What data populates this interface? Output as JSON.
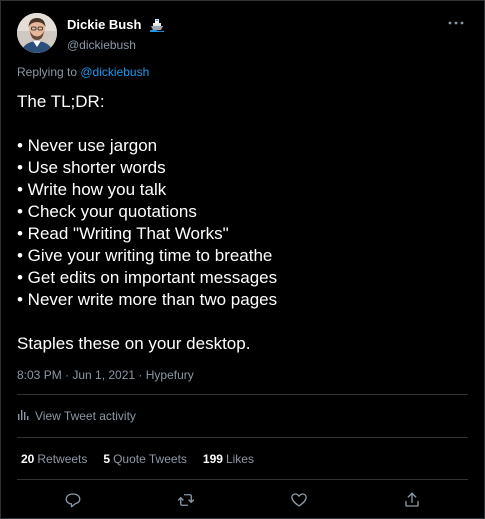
{
  "author": {
    "name": "Dickie Bush",
    "handle": "@dickiebush",
    "emoji": "ship-emoji-icon",
    "avatar": "avatar-photo"
  },
  "reply": {
    "prefix": "Replying to ",
    "mention": "@dickiebush"
  },
  "tweet": {
    "lines": [
      "The TL;DR:",
      "",
      "• Never use jargon",
      "• Use shorter words",
      "• Write how you talk",
      "• Check your quotations",
      "• Read \"Writing That Works\"",
      "• Give your writing time to breathe",
      "• Get edits on important messages",
      "• Never write more than two pages",
      "",
      "Staples these on your desktop."
    ]
  },
  "meta": {
    "text": "8:03 PM · Jun 1, 2021 · Hypefury"
  },
  "activity": {
    "label": "View Tweet activity",
    "icon": "bar-chart-icon"
  },
  "stats": {
    "retweets_count": "20",
    "retweets_label": "Retweets",
    "quotes_count": "5",
    "quotes_label": "Quote Tweets",
    "likes_count": "199",
    "likes_label": "Likes"
  },
  "actions": [
    "reply-icon",
    "retweet-icon",
    "like-icon",
    "share-icon"
  ],
  "colors": {
    "background": "#000000",
    "text": "#ffffff",
    "muted": "#8b98a5",
    "link": "#1d9bf0",
    "border": "#2f3336"
  }
}
